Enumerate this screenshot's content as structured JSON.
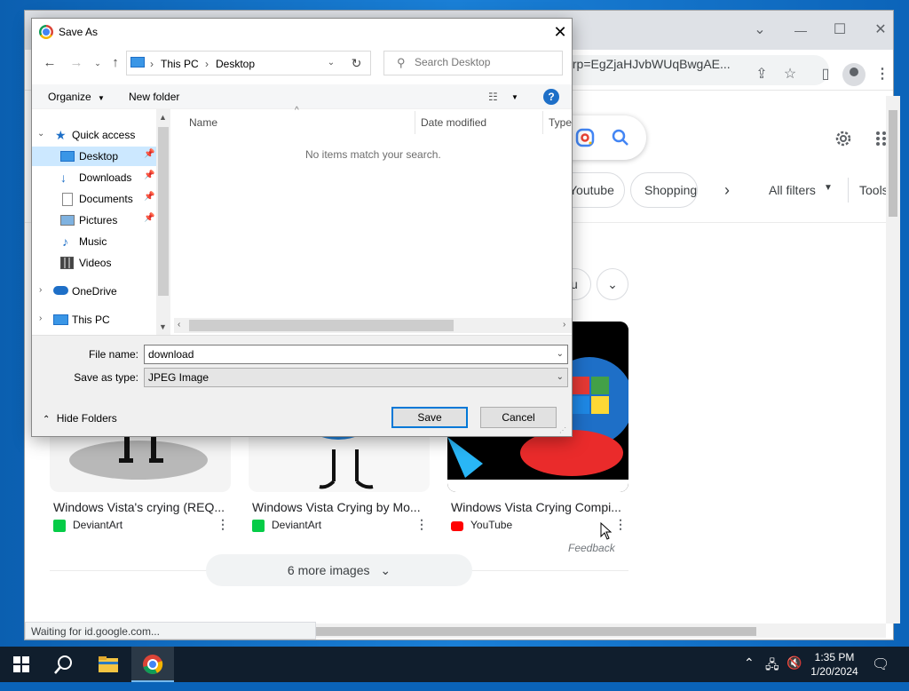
{
  "browser": {
    "url_fragment": "s_lcrp=EgZjaHJvbWUqBwgAE...",
    "status": "Waiting for id.google.com..."
  },
  "google": {
    "chips": [
      "Youtube",
      "Shopping"
    ],
    "all_filters": "All filters",
    "tools": "Tools",
    "partial_chip": "u",
    "results": [
      {
        "title": "Windows Vista's crying (REQ...",
        "source": "DeviantArt"
      },
      {
        "title": "Windows Vista Crying by Mo...",
        "source": "DeviantArt"
      },
      {
        "title": "Windows Vista Crying Compi...",
        "source": "YouTube"
      }
    ],
    "feedback": "Feedback",
    "more_images": "6 more images"
  },
  "dialog": {
    "title": "Save As",
    "breadcrumb": [
      "This PC",
      "Desktop"
    ],
    "search_placeholder": "Search Desktop",
    "organize": "Organize",
    "new_folder": "New folder",
    "nav": [
      {
        "label": "Quick access",
        "icon": "star-icon"
      },
      {
        "label": "Desktop",
        "icon": "desktop-icon",
        "selected": true,
        "pinned": true
      },
      {
        "label": "Downloads",
        "icon": "download-icon",
        "pinned": true
      },
      {
        "label": "Documents",
        "icon": "document-icon",
        "pinned": true
      },
      {
        "label": "Pictures",
        "icon": "pictures-icon",
        "pinned": true
      },
      {
        "label": "Music",
        "icon": "music-icon"
      },
      {
        "label": "Videos",
        "icon": "videos-icon"
      },
      {
        "label": "OneDrive",
        "icon": "cloud-icon"
      },
      {
        "label": "This PC",
        "icon": "pc-icon"
      }
    ],
    "columns": [
      "Name",
      "Date modified",
      "Type"
    ],
    "empty_message": "No items match your search.",
    "file_name_label": "File name:",
    "file_name_value": "download",
    "save_type_label": "Save as type:",
    "save_type_value": "JPEG Image",
    "hide_folders": "Hide Folders",
    "save": "Save",
    "cancel": "Cancel"
  },
  "taskbar": {
    "time": "1:35 PM",
    "date": "1/20/2024"
  },
  "colors": {
    "accent": "#0078d7",
    "selected": "#cce8ff",
    "taskbar": "#101e2d"
  }
}
